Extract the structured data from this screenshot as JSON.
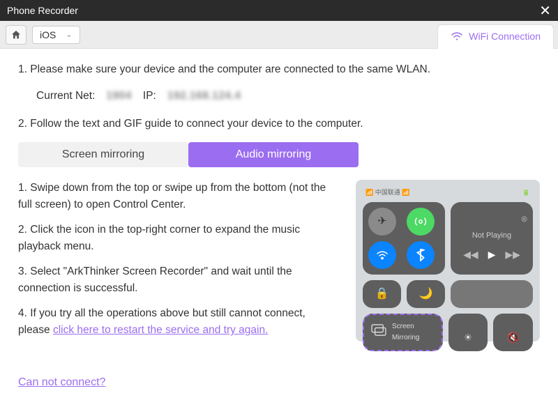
{
  "titlebar": {
    "title": "Phone Recorder"
  },
  "toolbar": {
    "platform": "iOS",
    "wifi_tab": "WiFi Connection"
  },
  "section1": {
    "line": "1. Please make sure your device and the computer are connected to the same WLAN.",
    "current_net_label": "Current Net:",
    "current_net_value": "1904",
    "ip_label": "IP:",
    "ip_value": "192.168.124.4"
  },
  "section2": {
    "line": "2. Follow the text and GIF guide to connect your device to the computer."
  },
  "tabs": {
    "screen": "Screen mirroring",
    "audio": "Audio mirroring"
  },
  "steps": {
    "s1": "1. Swipe down from the top or swipe up from the bottom (not the full screen) to open Control Center.",
    "s2": "2. Click the icon in the top-right corner to expand the music playback menu.",
    "s3": "3. Select \"ArkThinker Screen Recorder\" and wait until the connection is successful.",
    "s4a": "4. If you try all the operations above but still cannot connect, please ",
    "s4link": "click here to restart the service and try again."
  },
  "phone": {
    "carrier": "中国联通",
    "not_playing": "Not Playing",
    "screen_mirroring": "Screen Mirroring"
  },
  "footer": {
    "cannot_connect": "Can not connect?"
  }
}
